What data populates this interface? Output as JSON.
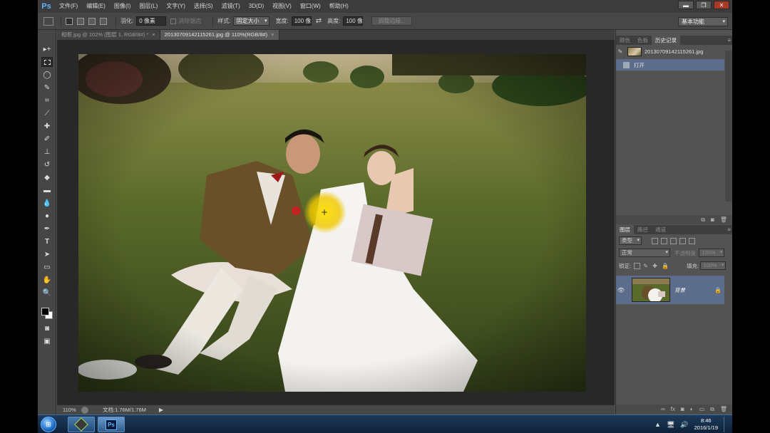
{
  "app": {
    "logo": "Ps",
    "menu": [
      "文件(F)",
      "编辑(E)",
      "图像(I)",
      "图层(L)",
      "文字(Y)",
      "选择(S)",
      "滤镜(T)",
      "3D(D)",
      "视图(V)",
      "窗口(W)",
      "帮助(H)"
    ],
    "window_buttons": {
      "minimize": "▬",
      "restore": "❐",
      "close": "✕"
    }
  },
  "options_bar": {
    "feather_label": "羽化:",
    "feather_value": "0 像素",
    "antialias_label": "消除锯齿",
    "style_label": "样式:",
    "style_value": "固定大小",
    "width_label": "宽度:",
    "width_value": "100 像",
    "swap_icon": "⇄",
    "height_label": "高度:",
    "height_value": "100 像",
    "refine_edge": "调整边缘...",
    "workspace": "基本功能"
  },
  "doc_tabs": [
    {
      "label": "相框.jpg @ 102% (图层 1, RGB/8#) *",
      "close": "×",
      "active": false
    },
    {
      "label": "20130709142115261.jpg @ 110%(RGB/8#)",
      "close": "×",
      "active": true
    }
  ],
  "status": {
    "zoom": "110%",
    "doc_info": "文档:1.76M/1.76M",
    "arrow": "▶"
  },
  "history_panel": {
    "tabs": [
      "颜色",
      "色板",
      "历史记录"
    ],
    "active_tab": 2,
    "menu_icon": "≡",
    "snapshot": "20130709142115261.jpg",
    "steps": [
      "打开"
    ],
    "footer_icons": [
      "⧉",
      "◙",
      "🗑"
    ]
  },
  "layers_panel": {
    "tabs": [
      "图层",
      "路径",
      "通道"
    ],
    "active_tab": 0,
    "menu_icon": "≡",
    "filter_type": "类型",
    "blend_mode": "正常",
    "opacity_label": "不透明度:",
    "opacity_value": "100%",
    "lock_label": "锁定:",
    "fill_label": "填充:",
    "fill_value": "100%",
    "layers": [
      {
        "name": "背景",
        "eye": "👁",
        "lock": "🔒"
      }
    ],
    "footer_icons": [
      "∞",
      "fx",
      "◙",
      "◐",
      "▭",
      "⧉",
      "🗑"
    ]
  },
  "taskbar": {
    "start": "⊞",
    "ps_label": "Ps",
    "time": "8:46",
    "date": "2016/1/19",
    "tray_icons": [
      "▲",
      "🖥",
      "🔊"
    ]
  }
}
